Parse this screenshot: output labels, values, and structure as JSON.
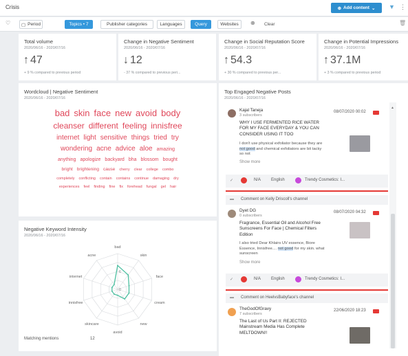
{
  "window": {
    "title": "Crisis"
  },
  "toolbar": {
    "add_content_label": "Add content"
  },
  "filters": {
    "period": "Period",
    "topics": "Topics • 7",
    "publisher_categories": "Publisher categories",
    "languages": "Languages",
    "query": "Query",
    "websites": "Websites",
    "clear": "Clear"
  },
  "kpis": [
    {
      "title": "Total volume",
      "date": "2020/06/16 - 2020/07/16",
      "value": "47",
      "sub": "+ 9 % compared to previous period"
    },
    {
      "title": "Change in Negative Sentiment",
      "date": "2020/06/16 - 2020/07/16",
      "value": "12",
      "sub": "- 37 % compared to previous peri..."
    },
    {
      "title": "Change in Social Reputation Score",
      "date": "2020/06/16 - 2020/07/16",
      "value": "54.3",
      "sub": "+ 30 % compared to previous per..."
    },
    {
      "title": "Change in Potential Impressions",
      "date": "2020/06/16 - 2020/07/16",
      "value": "37.1M",
      "sub": "+ 3 % compared to previous period"
    }
  ],
  "wordcloud": {
    "title": "Wordcloud | Negative Sentiment",
    "date": "2020/06/16 - 2020/07/16",
    "rows": [
      [
        "bad",
        "skin",
        "face",
        "new",
        "avoid",
        "body"
      ],
      [
        "cleanser",
        "different",
        "feeling",
        "innisfree"
      ],
      [
        "internet",
        "light",
        "sensitive",
        "things",
        "tried",
        "try"
      ],
      [
        "wondering",
        "acne",
        "advice",
        "aloe",
        "amazing"
      ],
      [
        "anything",
        "apologize",
        "backyard",
        "bha",
        "blossom",
        "bought"
      ],
      [
        "bright",
        "brightening",
        "cause",
        "cherry",
        "clear",
        "college",
        "combo"
      ],
      [
        "completely",
        "conflicting",
        "contain",
        "contains",
        "continue",
        "damaging",
        "dry"
      ],
      [
        "experiences",
        "feel",
        "finding",
        "fine",
        "fix",
        "forehead",
        "fungal",
        "gel",
        "hair"
      ]
    ]
  },
  "radar": {
    "title": "Negative Keyword Intensity",
    "date": "2020/06/16 - 2020/07/16",
    "axes": [
      "bad",
      "skin",
      "face",
      "cream",
      "new",
      "avoid",
      "skincare",
      "innisfree",
      "internet",
      "acne"
    ],
    "tick_labels": [
      "6",
      "0"
    ],
    "matching_label": "Matching mentions",
    "matching_value": "12"
  },
  "chart_data": {
    "type": "radar",
    "title": "Negative Keyword Intensity",
    "categories": [
      "bad",
      "skin",
      "face",
      "cream",
      "new",
      "avoid",
      "skincare",
      "innisfree",
      "internet",
      "acne"
    ],
    "values": [
      4,
      3,
      2,
      2,
      2,
      1,
      1,
      1,
      1,
      1
    ],
    "rlim": [
      0,
      6
    ]
  },
  "posts_panel": {
    "title": "Top Engaged Negative Posts",
    "date": "2020/06/16 - 2020/07/16",
    "posts": [
      {
        "author": "Kajal Taneja",
        "subs": "3 subscribers",
        "date": "08/07/2020 00:02",
        "title": "WHY I USE FERMENTED RICE WATER FOR MY FACE EVERYDAY & YOU CAN CONSIDER USING IT TOO",
        "snip_a": "I don't use physical exfoliator because they are ",
        "snip_hl": "not good",
        "snip_b": " and chemical exfoliators are bit tacky so not",
        "more": "Show more",
        "sentiment": "N/A",
        "language": "English",
        "category": "Trendy Cosmetics: I..."
      },
      {
        "channel": "Comment on Kelly Driscoll's channel",
        "author": "Dyet DG",
        "subs": "0 subscribers",
        "date": "08/07/2020 04:32",
        "title": "Fragrance, Essential Oil and Alcohol Free Sunscreens For Face | Chemical Filters Edition",
        "snip_a": "I also tried Dear Khlairs UV essence, Biore Essence, Innisfree.... ",
        "snip_hl": "not good",
        "snip_b": " for my skin. what sunscreen",
        "more": "Show more",
        "sentiment": "N/A",
        "language": "English",
        "category": "Trendy Cosmetics: I..."
      },
      {
        "channel": "Comment on HeelvsBabyface's channel",
        "author": "TheGodOfGravy",
        "subs": "7 subscribers",
        "date": "22/06/2020 18:23",
        "title": "The Last of Us Part II: REJECTED Mainstream Media Has Complete MELTDOWN!!"
      }
    ]
  },
  "colors": {
    "accent": "#2d8ecf",
    "active_chip": "#3598dc",
    "cloud_text": "#e0475a",
    "radar_line": "#4cbfa0",
    "youtube_red": "#e53935",
    "category_dot": "#c74adb"
  }
}
